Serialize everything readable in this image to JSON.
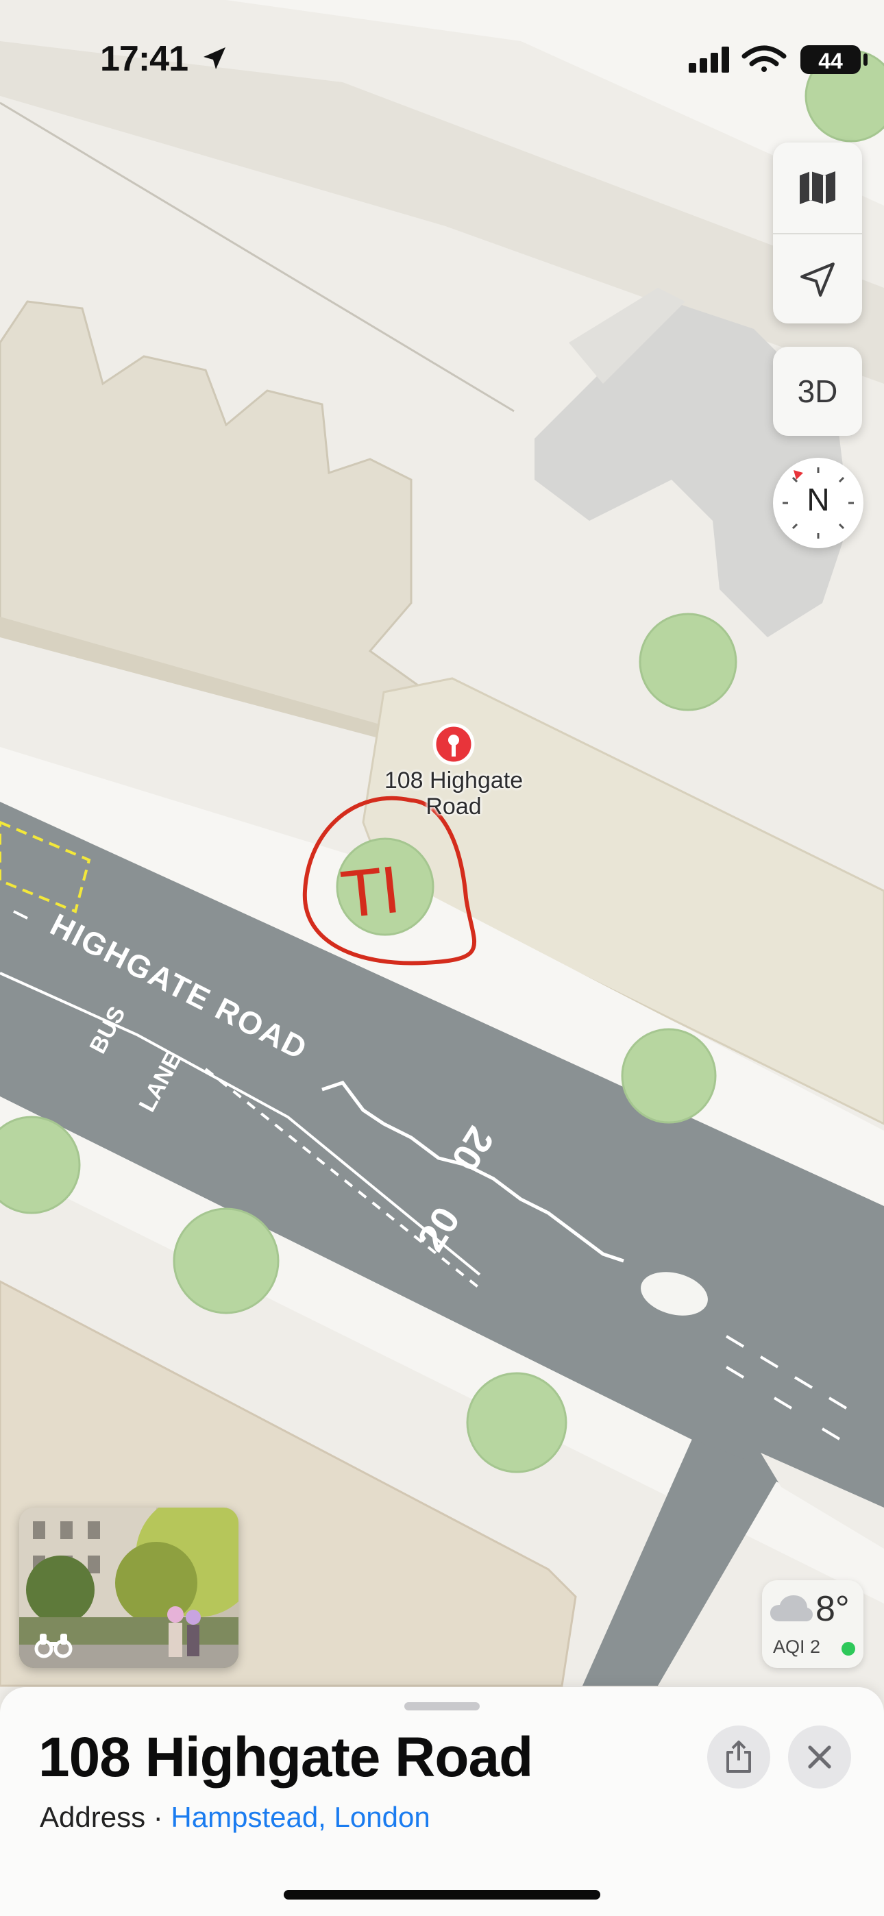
{
  "status_bar": {
    "time": "17:41",
    "battery": "44"
  },
  "map": {
    "road_name": "HIGHGATE ROAD",
    "road_marking_bus": "BUS",
    "road_marking_lane": "LANE",
    "speed_marking_1": "20",
    "speed_marking_2": "20",
    "annotation_text": "TI",
    "pin_label_line1": "108 Highgate",
    "pin_label_line2": "Road"
  },
  "controls": {
    "map_mode_icon": "map-icon",
    "location_icon": "location-arrow-icon",
    "three_d_label": "3D",
    "compass_label": "N"
  },
  "weather": {
    "temperature": "8°",
    "aqi": "AQI 2",
    "aqi_color": "#2ec85a"
  },
  "place": {
    "title": "108 Highgate Road",
    "type": "Address",
    "separator": " · ",
    "area": "Hampstead, London"
  },
  "colors": {
    "accent_link": "#1a7cf0",
    "pin_red": "#e8343a",
    "annotation_red": "#d42c1c",
    "road": "#8a9193"
  }
}
